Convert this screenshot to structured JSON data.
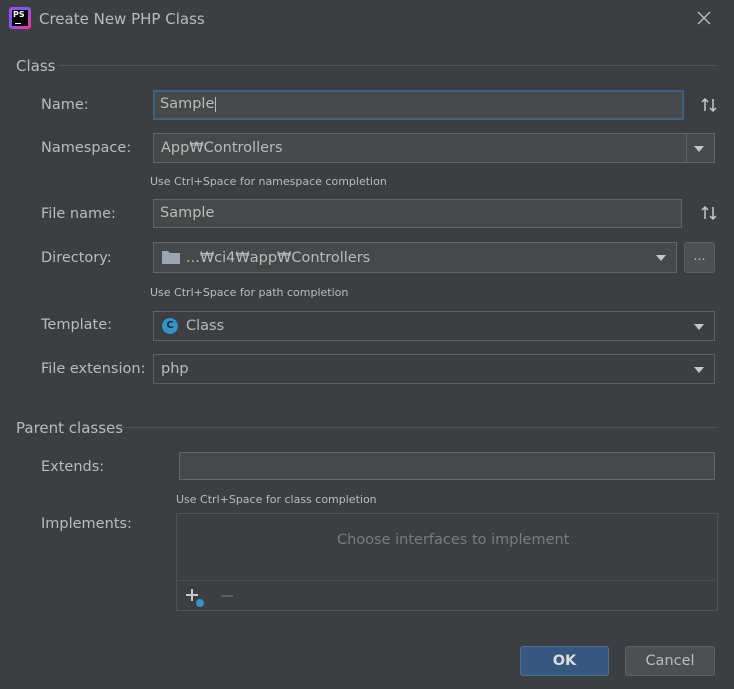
{
  "window": {
    "title": "Create New PHP Class",
    "app_icon_text": "PS"
  },
  "class_section": {
    "title": "Class",
    "name_label": "Name:",
    "name_value": "Sample",
    "namespace_label": "Namespace:",
    "namespace_value": "App₩Controllers",
    "namespace_hint": "Use Ctrl+Space for namespace completion",
    "file_name_label": "File name:",
    "file_name_value": "Sample",
    "directory_label": "Directory:",
    "directory_value": "...₩ci4₩app₩Controllers",
    "directory_hint": "Use Ctrl+Space for path completion",
    "browse_label": "...",
    "template_label": "Template:",
    "template_value": "Class",
    "template_icon_letter": "C",
    "extension_label": "File extension:",
    "extension_value": "php"
  },
  "parent_section": {
    "title": "Parent classes",
    "extends_label": "Extends:",
    "extends_value": "",
    "extends_hint": "Use Ctrl+Space for class completion",
    "implements_label": "Implements:",
    "implements_empty": "Choose interfaces to implement"
  },
  "buttons": {
    "ok": "OK",
    "cancel": "Cancel"
  },
  "colors": {
    "background": "#3c3f41",
    "focus": "#3d6185",
    "ok_button": "#365880",
    "class_icon": "#3592c4"
  }
}
